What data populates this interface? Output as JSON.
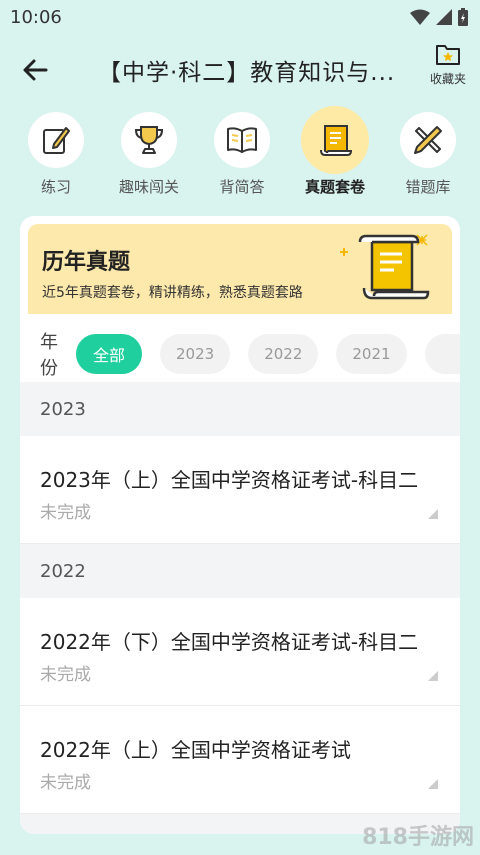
{
  "status_bar": {
    "time": "10:06"
  },
  "header": {
    "title": "【中学·科二】教育知识与...",
    "favorites_label": "收藏夹"
  },
  "tabs": [
    {
      "label": "练习",
      "icon": "edit-paper-icon",
      "active": false
    },
    {
      "label": "趣味闯关",
      "icon": "trophy-icon",
      "active": false
    },
    {
      "label": "背简答",
      "icon": "book-icon",
      "active": false
    },
    {
      "label": "真题套卷",
      "icon": "scroll-icon",
      "active": true
    },
    {
      "label": "错题库",
      "icon": "pencil-ruler-icon",
      "active": false
    }
  ],
  "banner": {
    "title": "历年真题",
    "subtitle": "近5年真题套卷，精讲精练，熟悉真题套路"
  },
  "filter": {
    "label": "年份",
    "chips": [
      "全部",
      "2023",
      "2022",
      "2021"
    ],
    "selected": "全部"
  },
  "sections": [
    {
      "year": "2023",
      "items": [
        {
          "title": "2023年（上）全国中学资格证考试-科目二",
          "status": "未完成"
        }
      ]
    },
    {
      "year": "2022",
      "items": [
        {
          "title": "2022年（下）全国中学资格证考试-科目二",
          "status": "未完成"
        },
        {
          "title": "2022年（上）全国中学资格证考试",
          "status": "未完成"
        }
      ]
    }
  ],
  "watermark": "818手游网",
  "colors": {
    "accent": "#1fcf9d",
    "banner": "#fde9ac",
    "background": "#d9f3ee",
    "active_tab": "#ffeaa5"
  }
}
